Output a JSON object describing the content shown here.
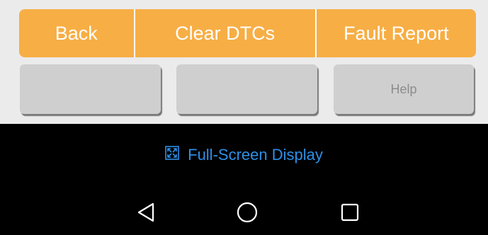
{
  "toolbar": {
    "back_label": "Back",
    "clear_dtcs_label": "Clear DTCs",
    "fault_report_label": "Fault Report",
    "accent_color": "#f7ae45"
  },
  "secondary_buttons": {
    "button1_label": "",
    "button2_label": "",
    "help_label": "Help"
  },
  "fullscreen": {
    "label": "Full-Screen Display",
    "icon": "fullscreen-expand-icon",
    "color": "#2f8fe6"
  },
  "navbar": {
    "back_icon": "triangle-back-icon",
    "home_icon": "circle-home-icon",
    "recent_icon": "square-recent-icon"
  }
}
